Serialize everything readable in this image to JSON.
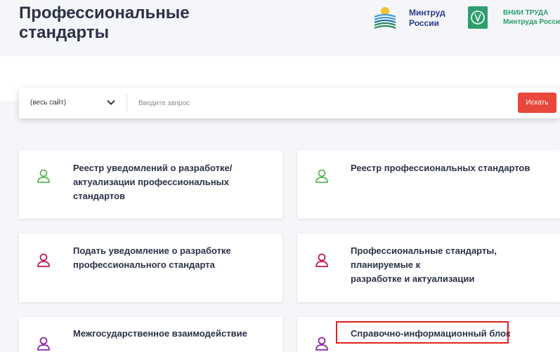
{
  "header": {
    "title_line1": "Профессиональные",
    "title_line2": "стандарты",
    "logo1": {
      "line1": "Минтруд",
      "line2": "России",
      "icon": "mintrud-rays-icon"
    },
    "logo2": {
      "line1": "ВНИИ ТРУДА",
      "line2": "Минтруда России",
      "icon": "vnii-truda-icon"
    }
  },
  "search": {
    "scope_value": "(весь сайт)",
    "placeholder": "Введите запрос",
    "button_label": "Искать"
  },
  "cards": [
    {
      "line1": "Реестр уведомлений о разработке/",
      "line2": "актуализации профессиональных стандартов",
      "icon_color": "#5cb85c",
      "icon": "user-icon"
    },
    {
      "line1": "Реестр профессиональных стандартов",
      "line2": "",
      "icon_color": "#5cb85c",
      "icon": "user-icon"
    },
    {
      "line1": "Подать уведомление о разработке",
      "line2": "профессионального стандарта",
      "icon_color": "#c2185b",
      "icon": "user-icon"
    },
    {
      "line1": "Профессиональные стандарты, планируемые к",
      "line2": "разработке и актуализации",
      "icon_color": "#c2185b",
      "icon": "user-icon"
    },
    {
      "line1": "Межгосударственное взаимодействие",
      "line2": "",
      "icon_color": "#8e24aa",
      "icon": "user-icon"
    },
    {
      "line1": "Справочно-информационный блок",
      "line2": "",
      "icon_color": "#8e24aa",
      "icon": "user-icon"
    }
  ],
  "colors": {
    "accent": "#e8473c",
    "highlight_border": "#e0211c",
    "text": "#2b3247"
  }
}
